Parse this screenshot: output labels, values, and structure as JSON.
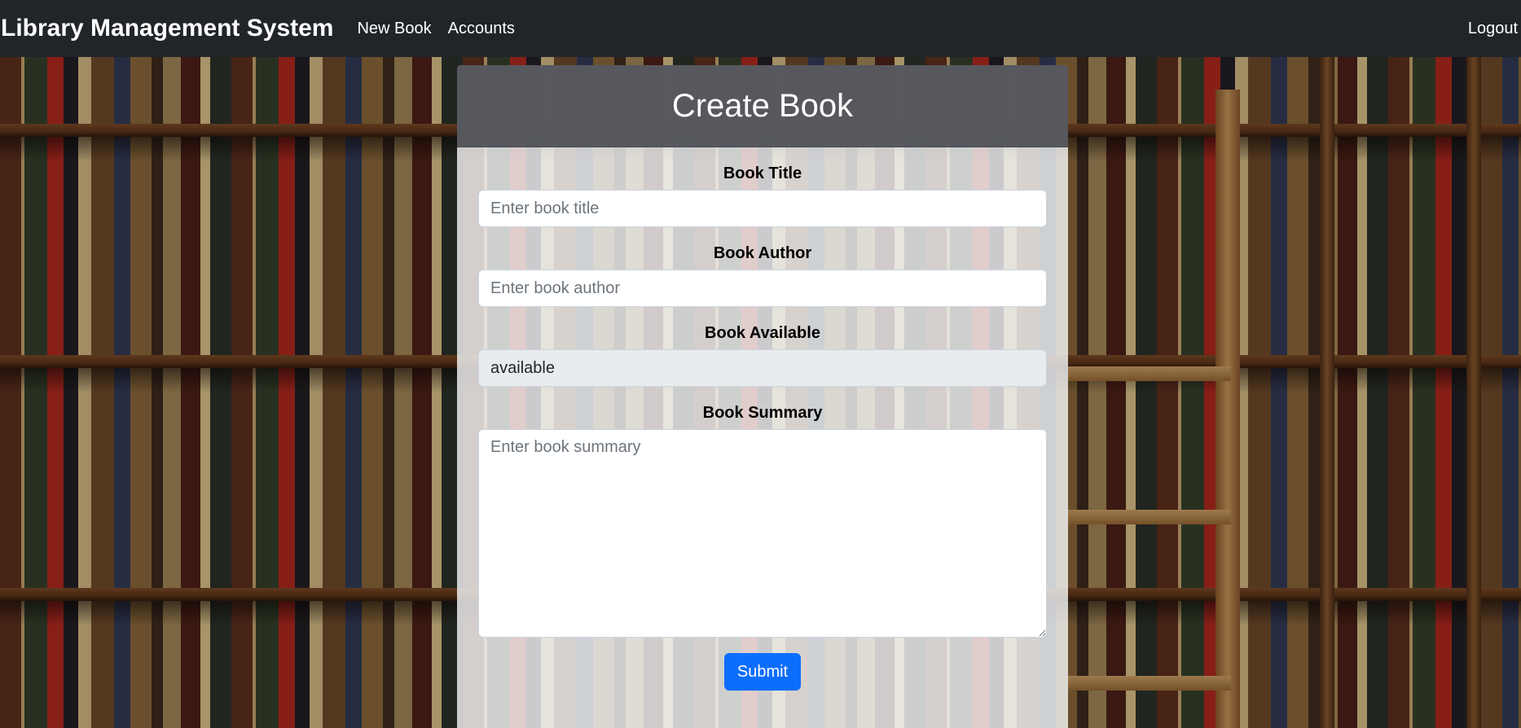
{
  "navbar": {
    "brand": "Library Management System",
    "links": [
      "New Book",
      "Accounts"
    ],
    "logout": "Logout"
  },
  "form": {
    "title": "Create Book",
    "fields": {
      "title": {
        "label": "Book Title",
        "placeholder": "Enter book title",
        "value": ""
      },
      "author": {
        "label": "Book Author",
        "placeholder": "Enter book author",
        "value": ""
      },
      "available": {
        "label": "Book Available",
        "value": "available"
      },
      "summary": {
        "label": "Book Summary",
        "placeholder": "Enter book summary",
        "value": ""
      }
    },
    "submit_label": "Submit"
  },
  "colors": {
    "navbar_bg": "#212529",
    "card_header_bg": "#4f5156",
    "submit_bg": "#0d6efd",
    "readonly_bg": "#e9ecef"
  }
}
